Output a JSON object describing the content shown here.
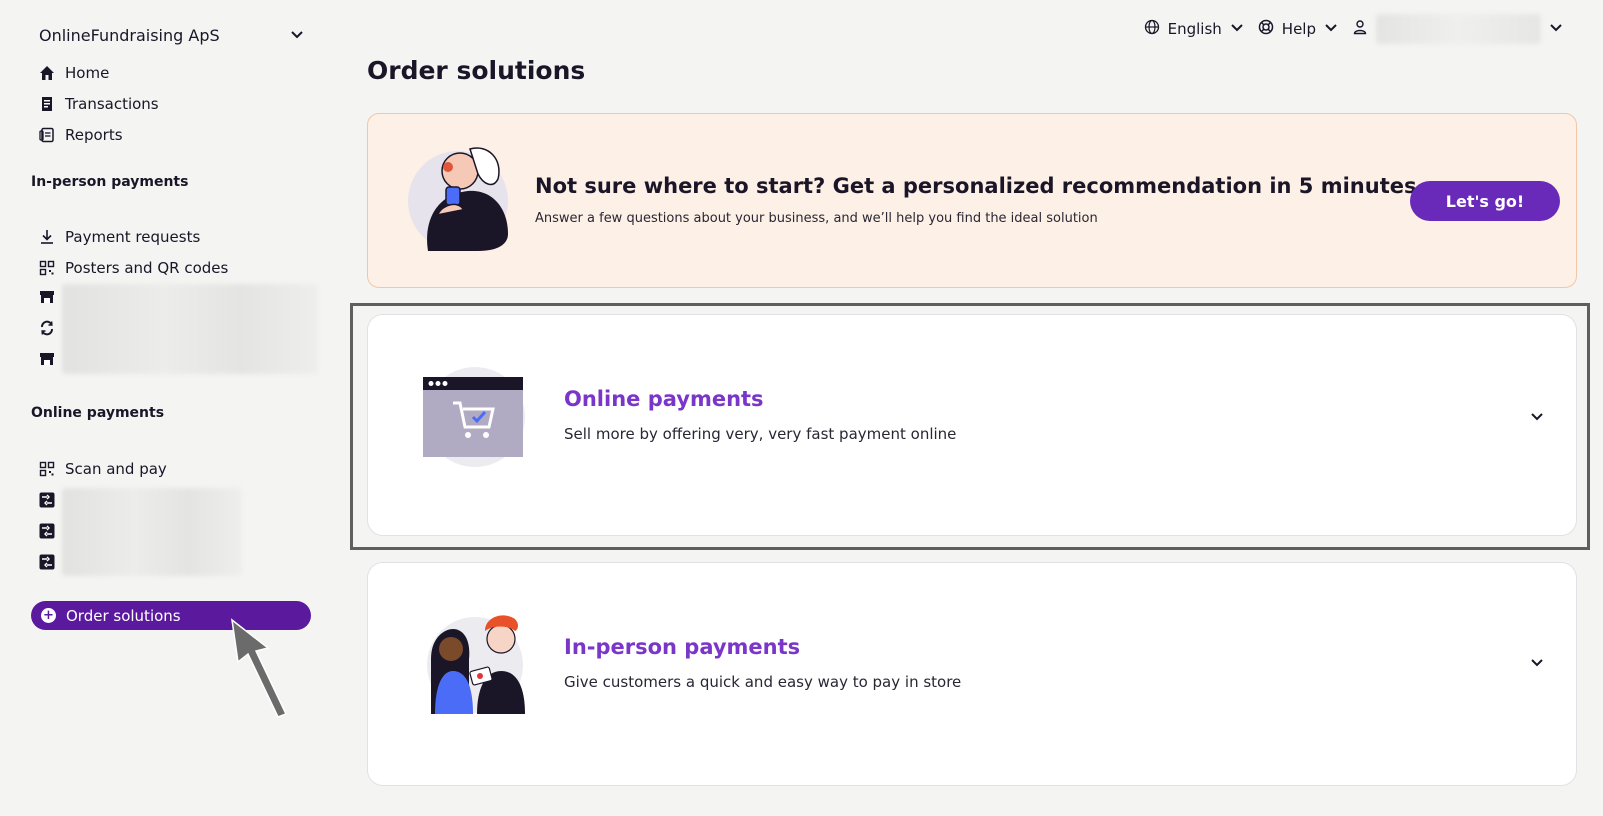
{
  "sidebar": {
    "org_name": "OnlineFundraising ApS",
    "nav": [
      {
        "label": "Home",
        "icon": "home-icon"
      },
      {
        "label": "Transactions",
        "icon": "receipt-icon"
      },
      {
        "label": "Reports",
        "icon": "reports-icon"
      }
    ],
    "in_person_label": "In-person payments",
    "in_person_items": [
      {
        "label": "Payment requests",
        "icon": "download-icon"
      },
      {
        "label": "Posters and QR codes",
        "icon": "qr-icon"
      }
    ],
    "online_label": "Online payments",
    "online_items": [
      {
        "label": "Scan and pay",
        "icon": "qr-icon"
      }
    ],
    "order_button": "Order solutions"
  },
  "topbar": {
    "language": "English",
    "help": "Help"
  },
  "main": {
    "title": "Order solutions",
    "promo": {
      "title": "Not sure where to start? Get a personalized recommendation in 5 minutes",
      "subtitle": "Answer a few questions about your business, and we’ll help you find the ideal solution",
      "button": "Let's go!"
    },
    "cards": [
      {
        "title": "Online payments",
        "subtitle": "Sell more by offering very, very fast payment online"
      },
      {
        "title": "In-person payments",
        "subtitle": "Give customers a quick and easy way to pay in store"
      }
    ]
  },
  "colors": {
    "accent": "#7a35c9",
    "sidebar_active": "#5b1a9e",
    "promo_bg": "#fdf0e6",
    "page_bg": "#f4f4f2"
  }
}
